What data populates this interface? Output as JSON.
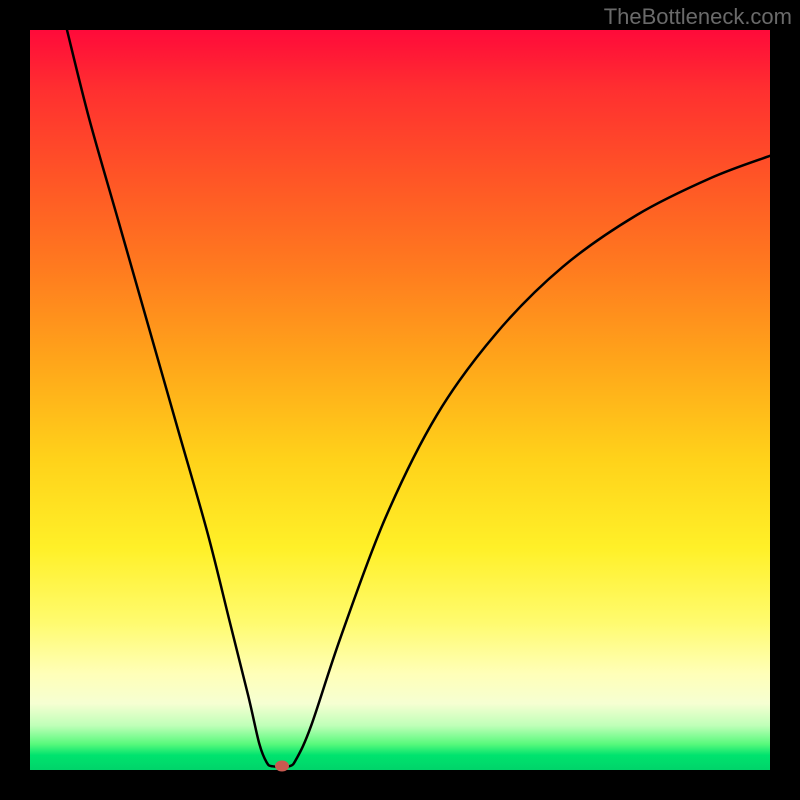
{
  "watermark": "TheBottleneck.com",
  "colors": {
    "frame_border": "#000000",
    "curve_stroke": "#000000",
    "marker_fill": "#c85a50",
    "gradient_top": "#ff0a3a",
    "gradient_bottom": "#00d46a"
  },
  "chart_data": {
    "type": "line",
    "title": "",
    "xlabel": "",
    "ylabel": "",
    "xlim": [
      0,
      100
    ],
    "ylim": [
      0,
      100
    ],
    "grid": false,
    "legend": false,
    "series": [
      {
        "name": "bottleneck-curve",
        "x": [
          5,
          8,
          12,
          16,
          20,
          24,
          27,
          29.5,
          31,
          32,
          32.8,
          35,
          36,
          38,
          42,
          48,
          55,
          63,
          72,
          82,
          92,
          100
        ],
        "values": [
          100,
          88,
          74,
          60,
          46,
          32,
          20,
          10,
          3.5,
          1,
          0.5,
          0.5,
          1.5,
          6,
          18,
          34,
          48,
          59,
          68,
          75,
          80,
          83
        ]
      }
    ],
    "annotations": [
      {
        "name": "optimal-point-marker",
        "x": 34,
        "y": 0.5
      }
    ],
    "note": "Axes are unlabeled in the source image; x and y are normalized 0–100 percent ranges. values[] is plotted with y=0 at the bottom (green) and y=100 at the top (red)."
  }
}
